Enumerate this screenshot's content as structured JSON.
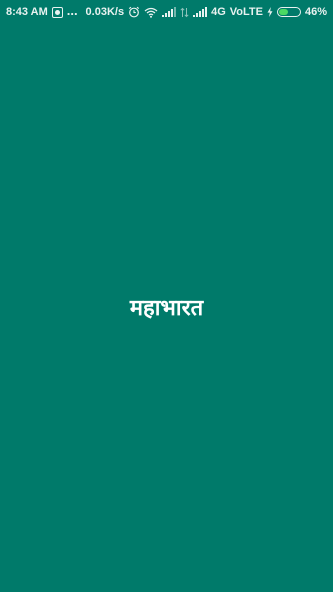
{
  "status_bar": {
    "time": "8:43 AM",
    "more_notifications": "...",
    "network_speed": "0.03K/s",
    "network_type": "4G",
    "volte": "VoLTE",
    "battery_percent": "46%",
    "battery_level": 0.46,
    "battery_color": "#4cd964",
    "icons": [
      "app-notification-icon",
      "alarm-icon",
      "wifi-icon",
      "signal-icon",
      "data-arrows-icon",
      "signal-icon",
      "charging-icon",
      "battery-icon"
    ]
  },
  "splash": {
    "title": "महाभारत",
    "background_color": "#007a6a"
  }
}
